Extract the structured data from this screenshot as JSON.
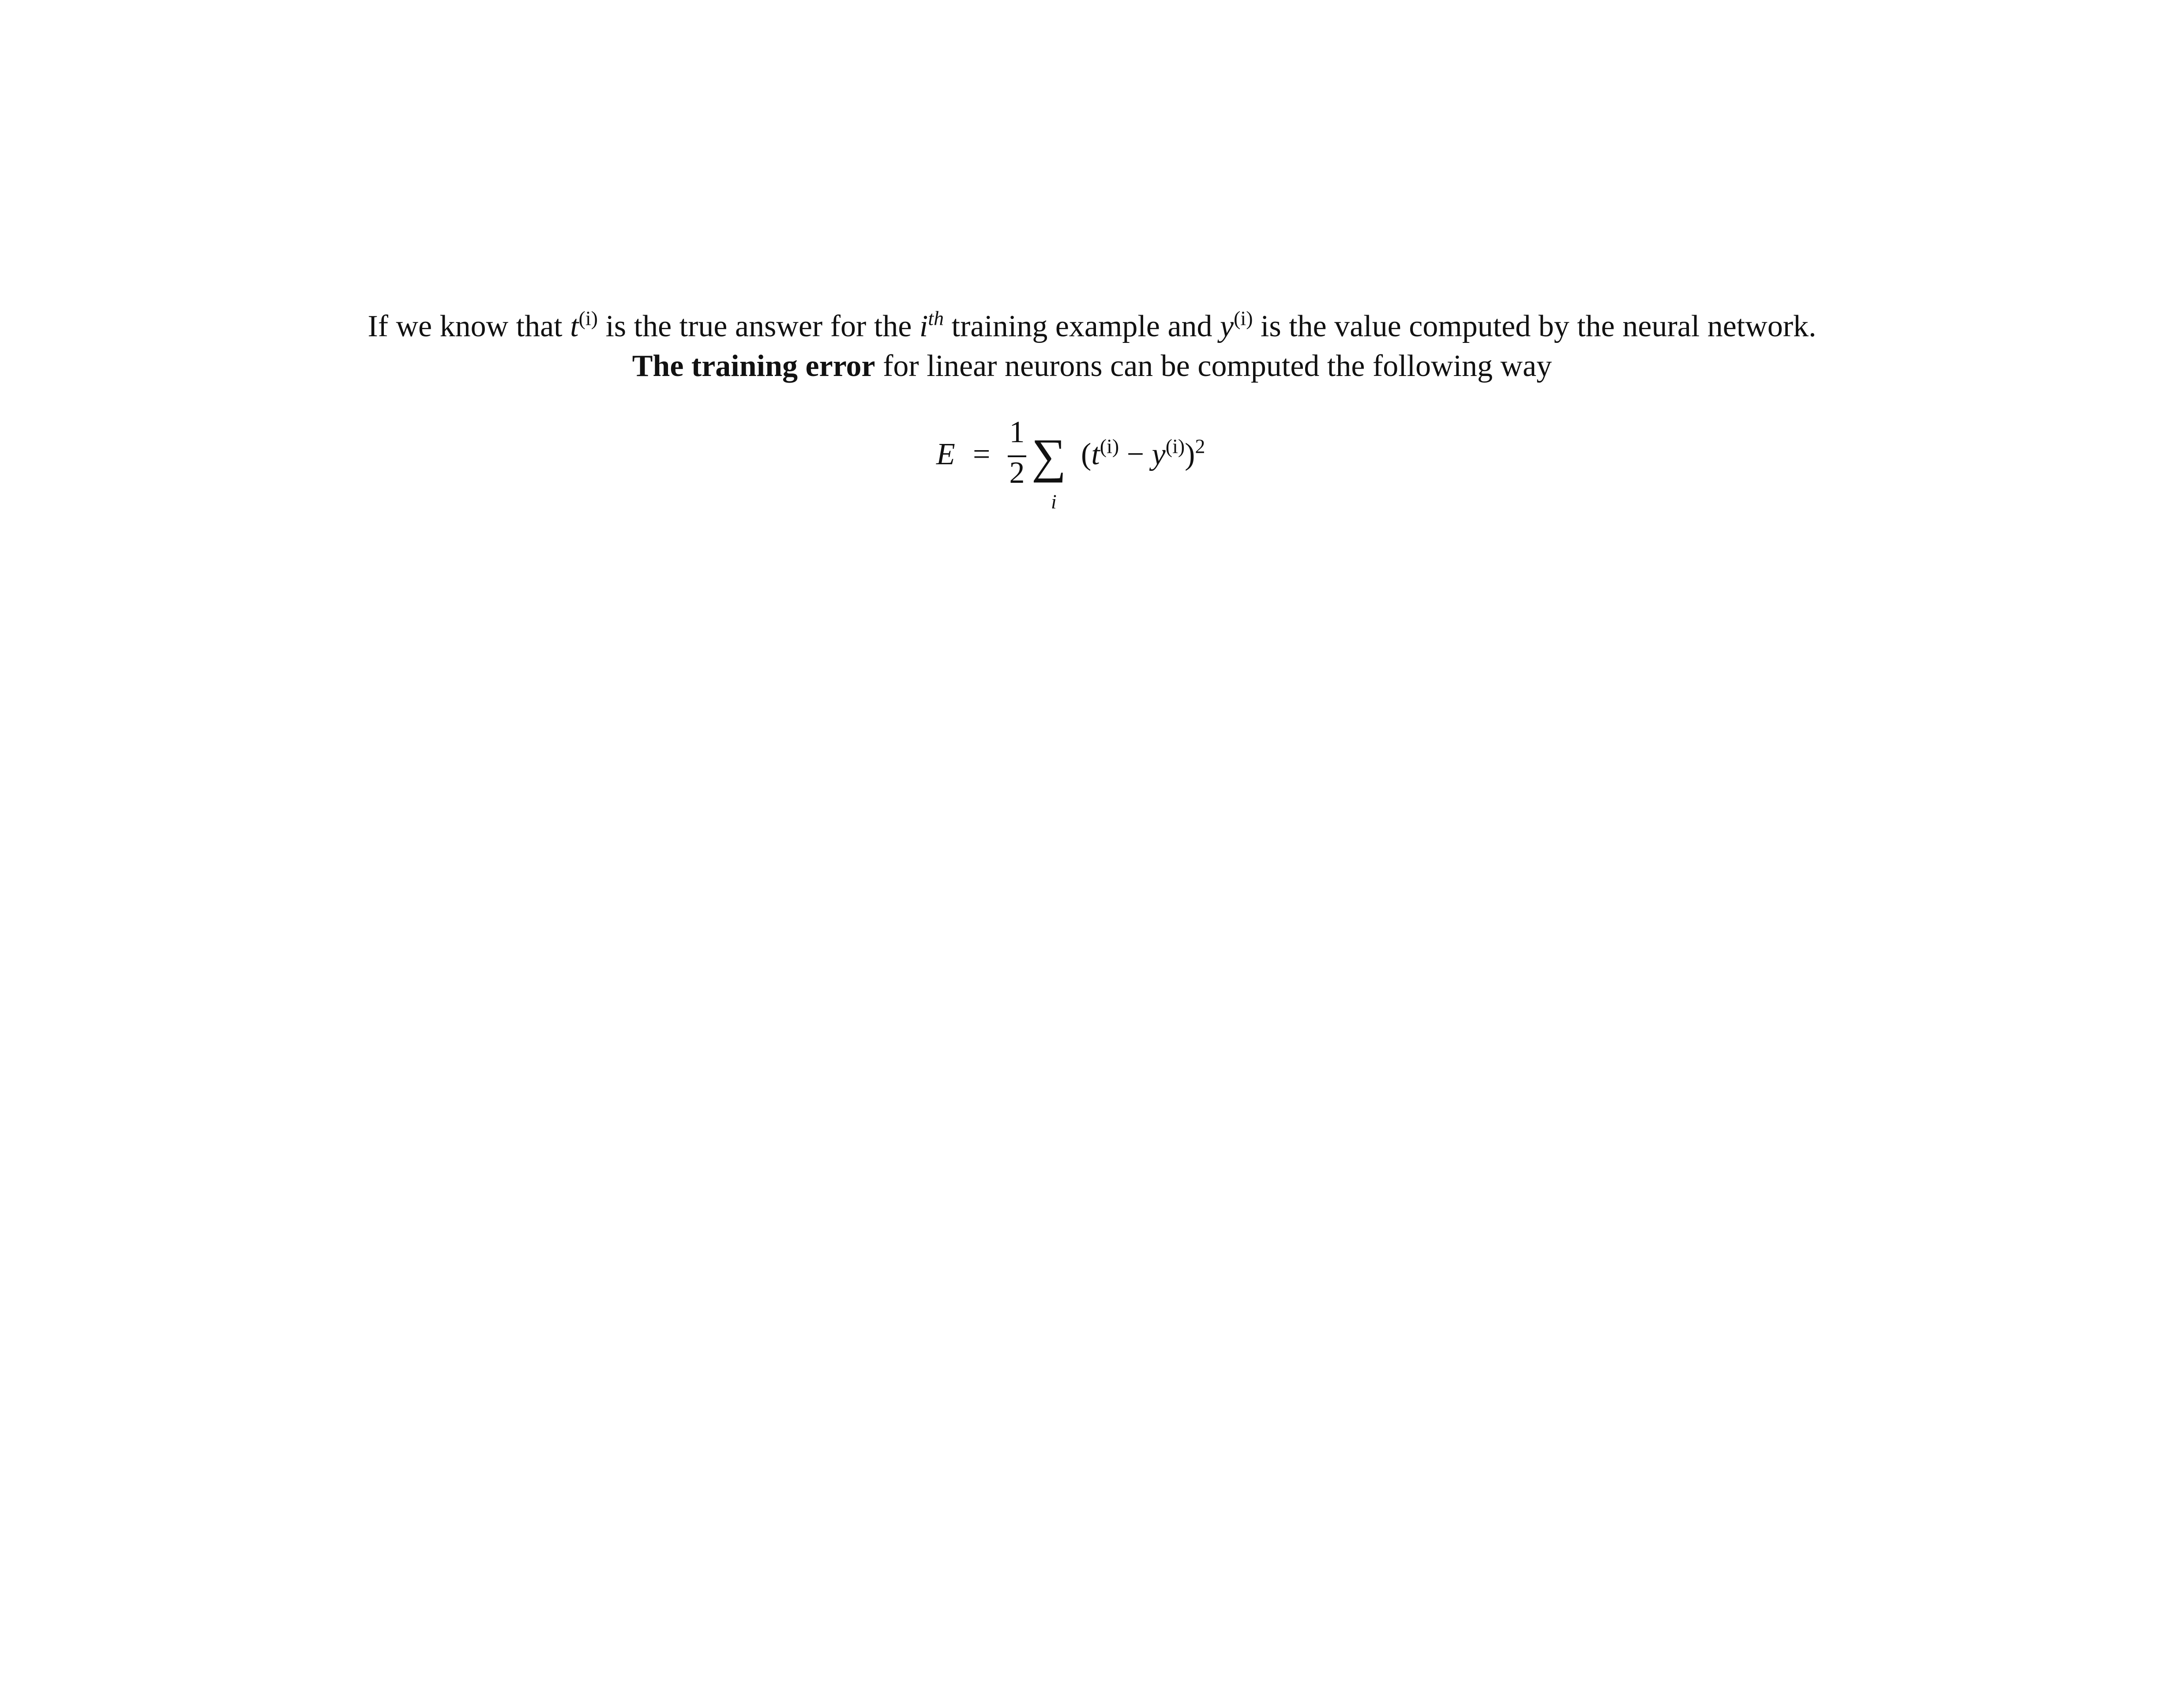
{
  "paragraph": {
    "line1": {
      "p1": "If we know that ",
      "t_var": "t",
      "sup_i": "(i)",
      "p2": " is the true answer for the ",
      "i_var": "i",
      "sup_th": "th",
      "p3": " training example and ",
      "y_var": "y",
      "p4": " is the value computed by the neural network."
    },
    "line2": {
      "bold": "The training error",
      "rest": " for linear neurons can be computed the following way"
    }
  },
  "equation": {
    "lhs": "E",
    "equals": "=",
    "numerator": "1",
    "denominator": "2",
    "sum": "∑",
    "sum_index": "i",
    "body_open": "(",
    "t": "t",
    "sup_i": "(i)",
    "minus": " − ",
    "y": "y",
    "body_close": ")",
    "power": "2"
  }
}
